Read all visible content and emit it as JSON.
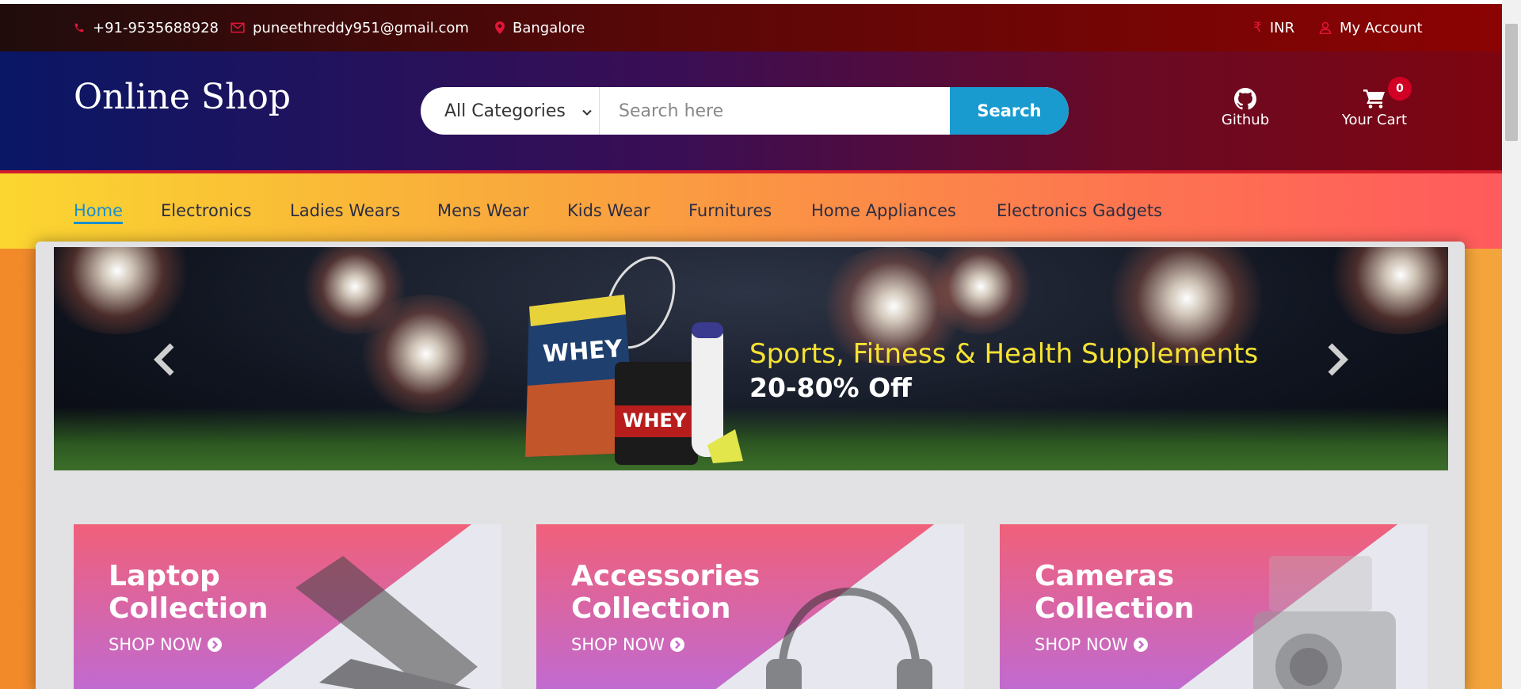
{
  "top_header": {
    "phone": "+91-9535688928",
    "email": "puneethreddy951@gmail.com",
    "location": "Bangalore",
    "currency": "INR",
    "account": "My Account"
  },
  "header": {
    "logo": "Online Shop",
    "category_selected": "All Categories",
    "search_placeholder": "Search here",
    "search_button": "Search",
    "github_label": "Github",
    "cart_label": "Your Cart",
    "cart_count": "0"
  },
  "nav": {
    "items": [
      "Home",
      "Electronics",
      "Ladies Wears",
      "Mens Wear",
      "Kids Wear",
      "Furnitures",
      "Home Appliances",
      "Electronics Gadgets"
    ],
    "active": "Home"
  },
  "banner": {
    "title": "Sports, Fitness & Health Supplements",
    "subtitle": "20-80% Off"
  },
  "collections": [
    {
      "line1": "Laptop",
      "line2": "Collection",
      "cta": "SHOP NOW"
    },
    {
      "line1": "Accessories",
      "line2": "Collection",
      "cta": "SHOP NOW"
    },
    {
      "line1": "Cameras",
      "line2": "Collection",
      "cta": "SHOP NOW"
    }
  ],
  "colors": {
    "accent_blue": "#1a9bd0",
    "brand_red": "#d10024",
    "nav_active": "#1a8fcc"
  },
  "icons": [
    "phone-icon",
    "mail-icon",
    "map-marker-icon",
    "rupee-icon",
    "user-icon",
    "github-icon",
    "cart-icon",
    "chevron-left-icon",
    "chevron-right-icon",
    "arrow-circle-right-icon"
  ]
}
